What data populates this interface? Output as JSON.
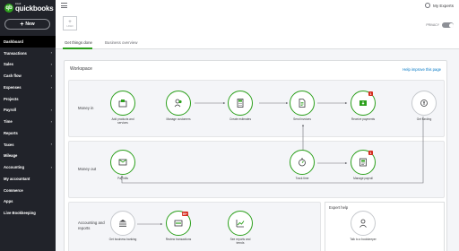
{
  "brand": {
    "intuit": "intuit",
    "name": "quickbooks",
    "logo_letter": "qb"
  },
  "new_button": {
    "label": "New",
    "icon": "plus-icon"
  },
  "nav": [
    {
      "label": "Dashboard",
      "active": true,
      "chevron": false
    },
    {
      "label": "Transactions",
      "chevron": true
    },
    {
      "label": "Sales",
      "chevron": true
    },
    {
      "label": "Cash flow",
      "chevron": true
    },
    {
      "label": "Expenses",
      "chevron": true
    },
    {
      "label": "Projects",
      "chevron": false
    },
    {
      "label": "Payroll",
      "chevron": true
    },
    {
      "label": "Time",
      "chevron": true
    },
    {
      "label": "Reports",
      "chevron": false
    },
    {
      "label": "Taxes",
      "chevron": true
    },
    {
      "label": "Mileage",
      "chevron": false
    },
    {
      "label": "Accounting",
      "chevron": true
    },
    {
      "label": "My accountant",
      "chevron": false
    },
    {
      "label": "Commerce",
      "chevron": false
    },
    {
      "label": "Apps",
      "chevron": false
    },
    {
      "label": "Live Bookkeeping",
      "chevron": false
    }
  ],
  "topbar": {
    "logo_plus": "+",
    "logo_text": "LOGO",
    "user_name": "My Experts",
    "privacy_label": "PRIVACY"
  },
  "tabs": [
    {
      "label": "Get things done",
      "active": true
    },
    {
      "label": "Business overview",
      "active": false
    }
  ],
  "workspace": {
    "title": "Workspace",
    "help_link": "Help improve this page",
    "rows": {
      "money_in": "Money in",
      "money_out": "Money out",
      "accounting": "Accounting and reports"
    },
    "expert_help_title": "Expert help",
    "nodes": {
      "add_products": {
        "label": "Add products and services",
        "icon": "box-icon"
      },
      "manage_customers": {
        "label": "Manage customers",
        "icon": "people-icon"
      },
      "create_estimates": {
        "label": "Create estimates",
        "icon": "calculator-icon"
      },
      "send_invoices": {
        "label": "Send invoices",
        "icon": "invoice-icon"
      },
      "receive_payments": {
        "label": "Receive payments",
        "icon": "payment-icon",
        "badge": "1"
      },
      "get_funding": {
        "label": "Get funding",
        "icon": "funding-icon"
      },
      "pay_bills": {
        "label": "Pay bills",
        "icon": "envelope-dollar-icon"
      },
      "track_time": {
        "label": "Track time",
        "icon": "stopwatch-icon"
      },
      "manage_payroll": {
        "label": "Manage payroll",
        "icon": "payroll-icon",
        "badge": "1"
      },
      "get_banking": {
        "label": "Get business banking",
        "icon": "bank-icon"
      },
      "review_transactions": {
        "label": "Review transactions",
        "icon": "review-icon",
        "badge": "99+"
      },
      "see_reports": {
        "label": "See reports and trends",
        "icon": "chart-icon"
      },
      "talk_bookkeeper": {
        "label": "Talk to a bookkeeper",
        "icon": "person-icon"
      }
    }
  },
  "colors": {
    "accent": "#2ca01c",
    "sidebar": "#21232a",
    "link": "#0077c5",
    "badge": "#d52b1e"
  }
}
